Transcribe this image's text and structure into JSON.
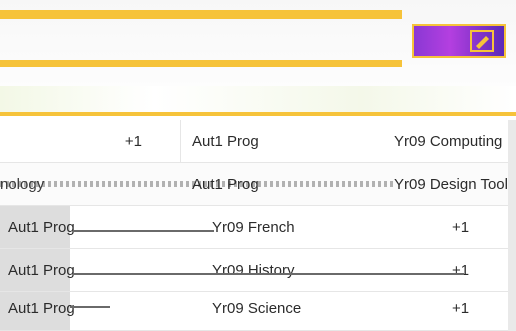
{
  "rows": [
    {
      "count": "+1",
      "term": "Aut1 Prog",
      "subject": "Yr09 Computing"
    },
    {
      "subject_prefix": "nology",
      "term": "Aut1 Prog",
      "subject": "Yr09 Design Tool"
    },
    {
      "term": "Aut1 Prog",
      "subject": "Yr09 French",
      "count": "+1"
    },
    {
      "term": "Aut1 Prog",
      "subject": "Yr09 History",
      "count": "+1"
    },
    {
      "term": "Aut1 Prog",
      "subject": "Yr09 Science",
      "count": "+1"
    }
  ],
  "colors": {
    "accent_yellow": "#f6c33a",
    "accent_purple": "#8a38d4",
    "divider": "#e6e6e6"
  },
  "icons": {
    "badge": "pencil-icon"
  }
}
